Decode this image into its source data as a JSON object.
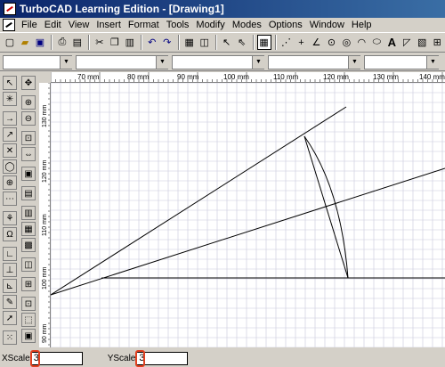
{
  "window": {
    "title": "TurboCAD Learning Edition - [Drawing1]"
  },
  "menu": [
    "File",
    "Edit",
    "View",
    "Insert",
    "Format",
    "Tools",
    "Modify",
    "Modes",
    "Options",
    "Window",
    "Help"
  ],
  "toolbar_icons": [
    "new-document-icon",
    "open-folder-icon",
    "save-icon",
    "print-icon",
    "print-preview-icon",
    "cut-icon",
    "copy-icon",
    "paste-icon",
    "undo-icon",
    "redo-icon",
    "property-icon",
    "layer-icon",
    "select-icon",
    "select-edit-icon",
    "table-icon",
    "point-icon",
    "crosshair-icon",
    "angle-icon",
    "circle-icon",
    "ring-icon",
    "arc-icon",
    "ellipse-icon",
    "text-icon",
    "dimension-icon",
    "hatch-icon",
    "insert-icon"
  ],
  "ruler": {
    "top_labels": [
      "70 mm",
      "80 mm",
      "90 mm",
      "100 mm",
      "110 mm",
      "120 mm",
      "130 mm",
      "140 mm"
    ],
    "left_labels": [
      "130 mm",
      "120 mm",
      "110 mm",
      "100 mm",
      "90 mm"
    ]
  },
  "status": {
    "xscale_label": "XScale",
    "xscale_value": "3",
    "yscale_label": "YScale",
    "yscale_value": "3"
  },
  "colors": {
    "titlebar_start": "#0a246a",
    "titlebar_end": "#3a6ea5",
    "highlight": "#e04020",
    "grid": "#c8c8dc"
  }
}
